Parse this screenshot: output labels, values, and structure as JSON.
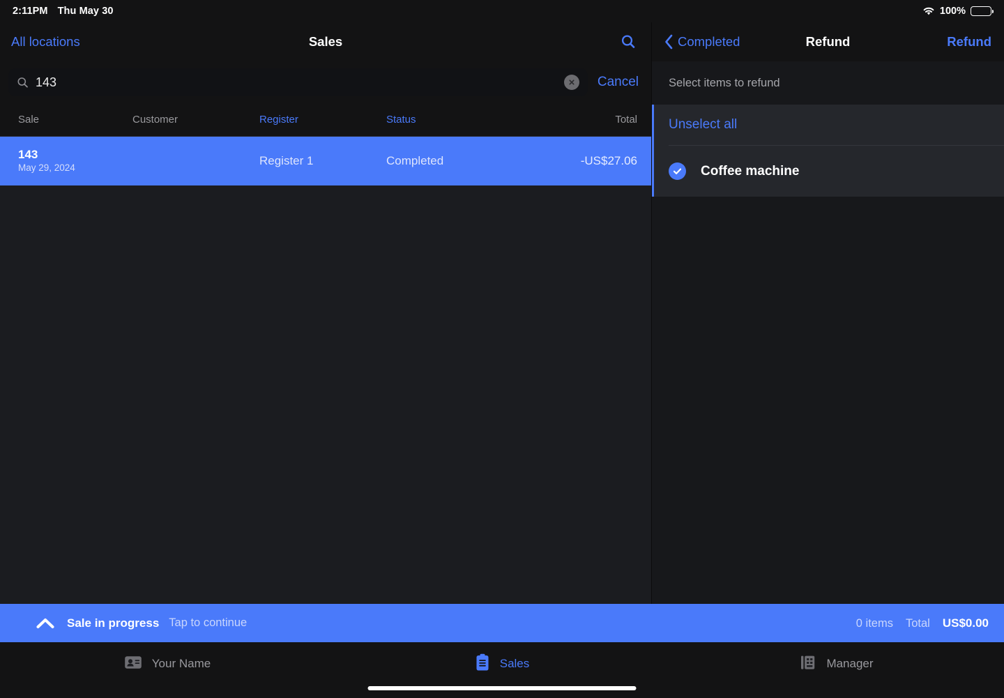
{
  "status_bar": {
    "time": "2:11PM",
    "date": "Thu May 30",
    "battery_percent": "100%",
    "wifi_icon": "wifi-icon",
    "battery_icon": "battery-icon"
  },
  "colors": {
    "accent": "#4a7afa",
    "page_bg": "#17181b",
    "panel_bg": "#1b1c20",
    "header_bg": "#131314",
    "card_bg": "#25272c",
    "muted_text": "#9a9a9e"
  },
  "left_pane": {
    "header": {
      "back_label": "All locations",
      "title": "Sales",
      "search_icon": "search-icon"
    },
    "search": {
      "value": "143",
      "placeholder": "Search",
      "magnifier_icon": "search-icon",
      "clear_icon": "clear-circle-icon",
      "cancel_label": "Cancel"
    },
    "table": {
      "columns": [
        {
          "label": "Sale",
          "active": false
        },
        {
          "label": "Customer",
          "active": false
        },
        {
          "label": "Register",
          "active": true
        },
        {
          "label": "Status",
          "active": true
        },
        {
          "label": "Total",
          "active": false
        }
      ],
      "rows": [
        {
          "sale_number": "143",
          "sale_date": "May 29, 2024",
          "customer": "",
          "register": "Register 1",
          "status": "Completed",
          "total": "-US$27.06",
          "selected": true
        }
      ]
    }
  },
  "right_pane": {
    "header": {
      "back_label": "Completed",
      "back_icon": "chevron-left-icon",
      "title": "Refund",
      "action_label": "Refund"
    },
    "subheading": "Select items to refund",
    "unselect_all_label": "Unselect all",
    "items": [
      {
        "label": "Coffee machine",
        "checked": true,
        "check_icon": "check-circle-icon"
      }
    ]
  },
  "progress_bar": {
    "chevron_icon": "chevron-up-icon",
    "title": "Sale in progress",
    "subtitle": "Tap to continue",
    "items_count": "0 items",
    "total_label": "Total",
    "total_value": "US$0.00"
  },
  "tab_bar": {
    "tabs": [
      {
        "label": "Your Name",
        "icon": "contact-card-icon",
        "active": false
      },
      {
        "label": "Sales",
        "icon": "clipboard-icon",
        "active": true
      },
      {
        "label": "Manager",
        "icon": "building-icon",
        "active": false
      }
    ]
  }
}
